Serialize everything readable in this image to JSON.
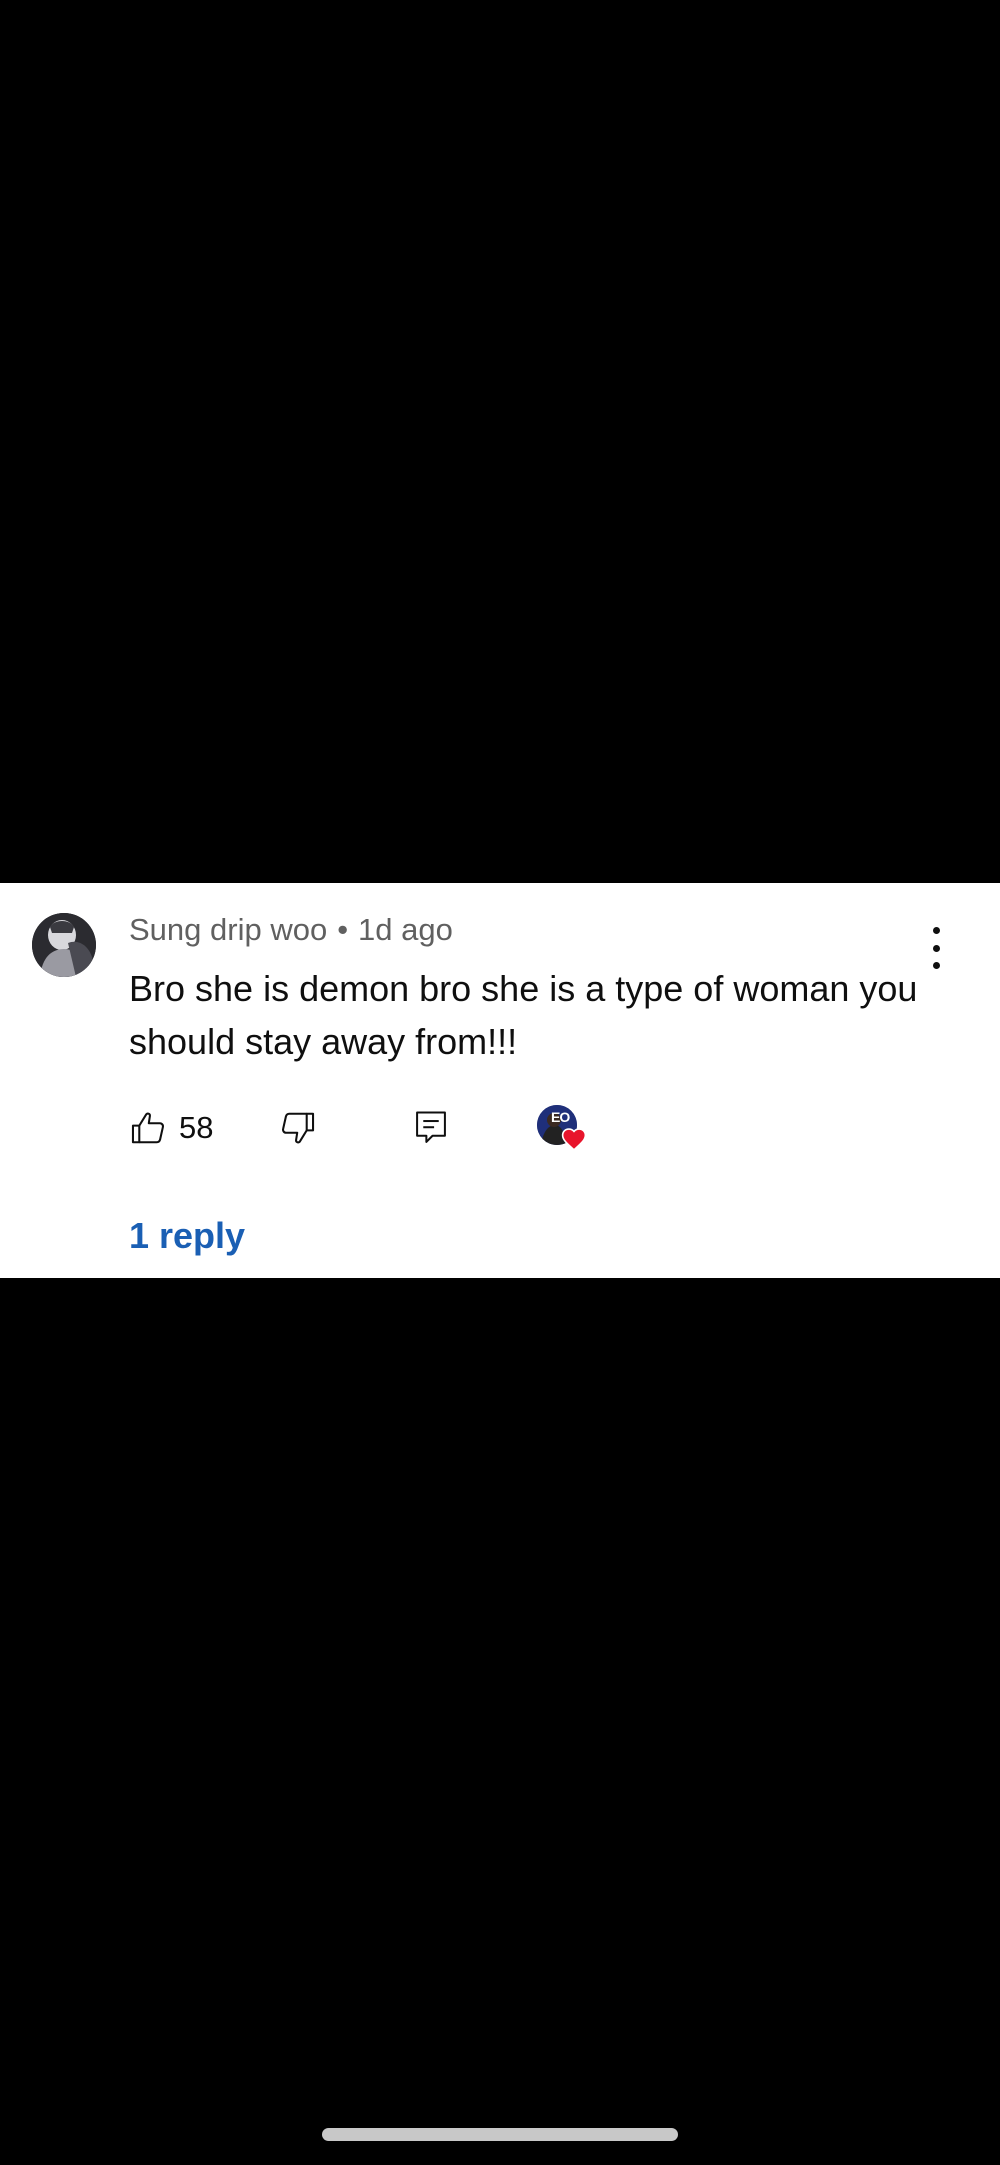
{
  "comment": {
    "author": "Sung drip woo",
    "separator": "•",
    "timestamp": "1d ago",
    "text": "Bro she is demon bro she is a type of woman you should stay away from!!!",
    "like_count": "58",
    "creator_avatar_initials": "EO",
    "replies_label": "1 reply"
  },
  "icons": {
    "like": "thumbs-up-icon",
    "dislike": "thumbs-down-icon",
    "reply": "comment-icon",
    "more": "more-vertical-icon",
    "heart": "heart-icon"
  },
  "colors": {
    "link": "#1a5fb4",
    "heart": "#e8142b",
    "background": "#000000",
    "card": "#ffffff"
  }
}
